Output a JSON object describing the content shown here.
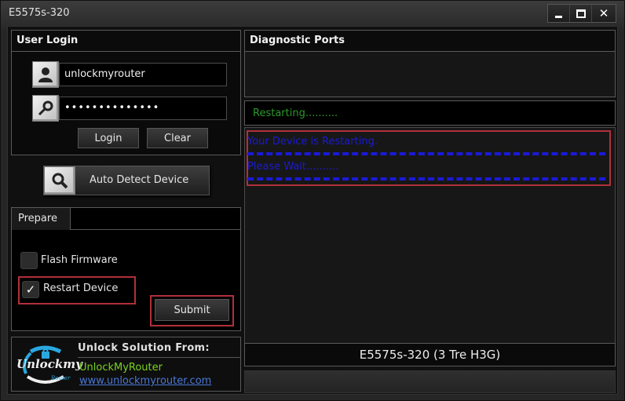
{
  "window": {
    "title": "E5575s-320",
    "controls": {
      "minimize": "_",
      "maximize": "☐",
      "close": "✕"
    }
  },
  "login": {
    "header": "User Login",
    "username_value": "unlockmyrouter",
    "password_value": "••••••••••••••",
    "user_icon": "user-icon",
    "key_icon": "key-icon",
    "login_label": "Login",
    "clear_label": "Clear"
  },
  "auto_detect": {
    "label": "Auto Detect Device",
    "icon": "search-icon"
  },
  "prepare": {
    "tab_label": "Prepare",
    "options": [
      {
        "label": "Flash Firmware",
        "checked": false
      },
      {
        "label": "Restart Device",
        "checked": true
      }
    ],
    "check_glyph": "✓",
    "submit_label": "Submit"
  },
  "brand": {
    "logo_text": "Unlockmy",
    "logo_sub": "Router",
    "title": "Unlock Solution From:",
    "name": "UnlockMyRouter",
    "url": "www.unlockmyrouter.com"
  },
  "diagnostic": {
    "header": "Diagnostic Ports"
  },
  "status": {
    "text": "Restarting.........."
  },
  "log": {
    "lines": [
      "Your Device is Restarting.",
      "Please Wait.........."
    ]
  },
  "device": {
    "label": "E5575s-320 (3 Tre H3G)"
  },
  "progress": {
    "percent": 0
  }
}
